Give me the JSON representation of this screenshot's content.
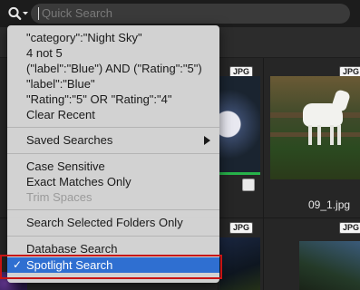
{
  "search": {
    "placeholder": "Quick Search",
    "icon": "magnifier-dropdown-icon"
  },
  "grid": {
    "badges": [
      "JPG",
      "JPG",
      "JPG",
      "JPG"
    ],
    "caption": "09_1.jpg"
  },
  "menu": {
    "recent": [
      "\"category\":\"Night Sky\"",
      "4 not 5",
      "(\"label\":\"Blue\") AND (\"Rating\":\"5\")",
      "\"label\":\"Blue\"",
      "\"Rating\":\"5\" OR \"Rating\":\"4\"",
      "Clear Recent"
    ],
    "saved_searches": "Saved Searches",
    "options": {
      "case_sensitive": "Case Sensitive",
      "exact_matches": "Exact Matches Only",
      "trim_spaces": "Trim Spaces"
    },
    "search_selected": "Search Selected Folders Only",
    "database_search": "Database Search",
    "spotlight_search": "Spotlight Search",
    "checkmark": "✓"
  },
  "colors": {
    "menu_bg": "#d8d8d8",
    "selected": "#2f6fd1",
    "highlight_border": "#c81414",
    "green_bar": "#27b34a"
  }
}
